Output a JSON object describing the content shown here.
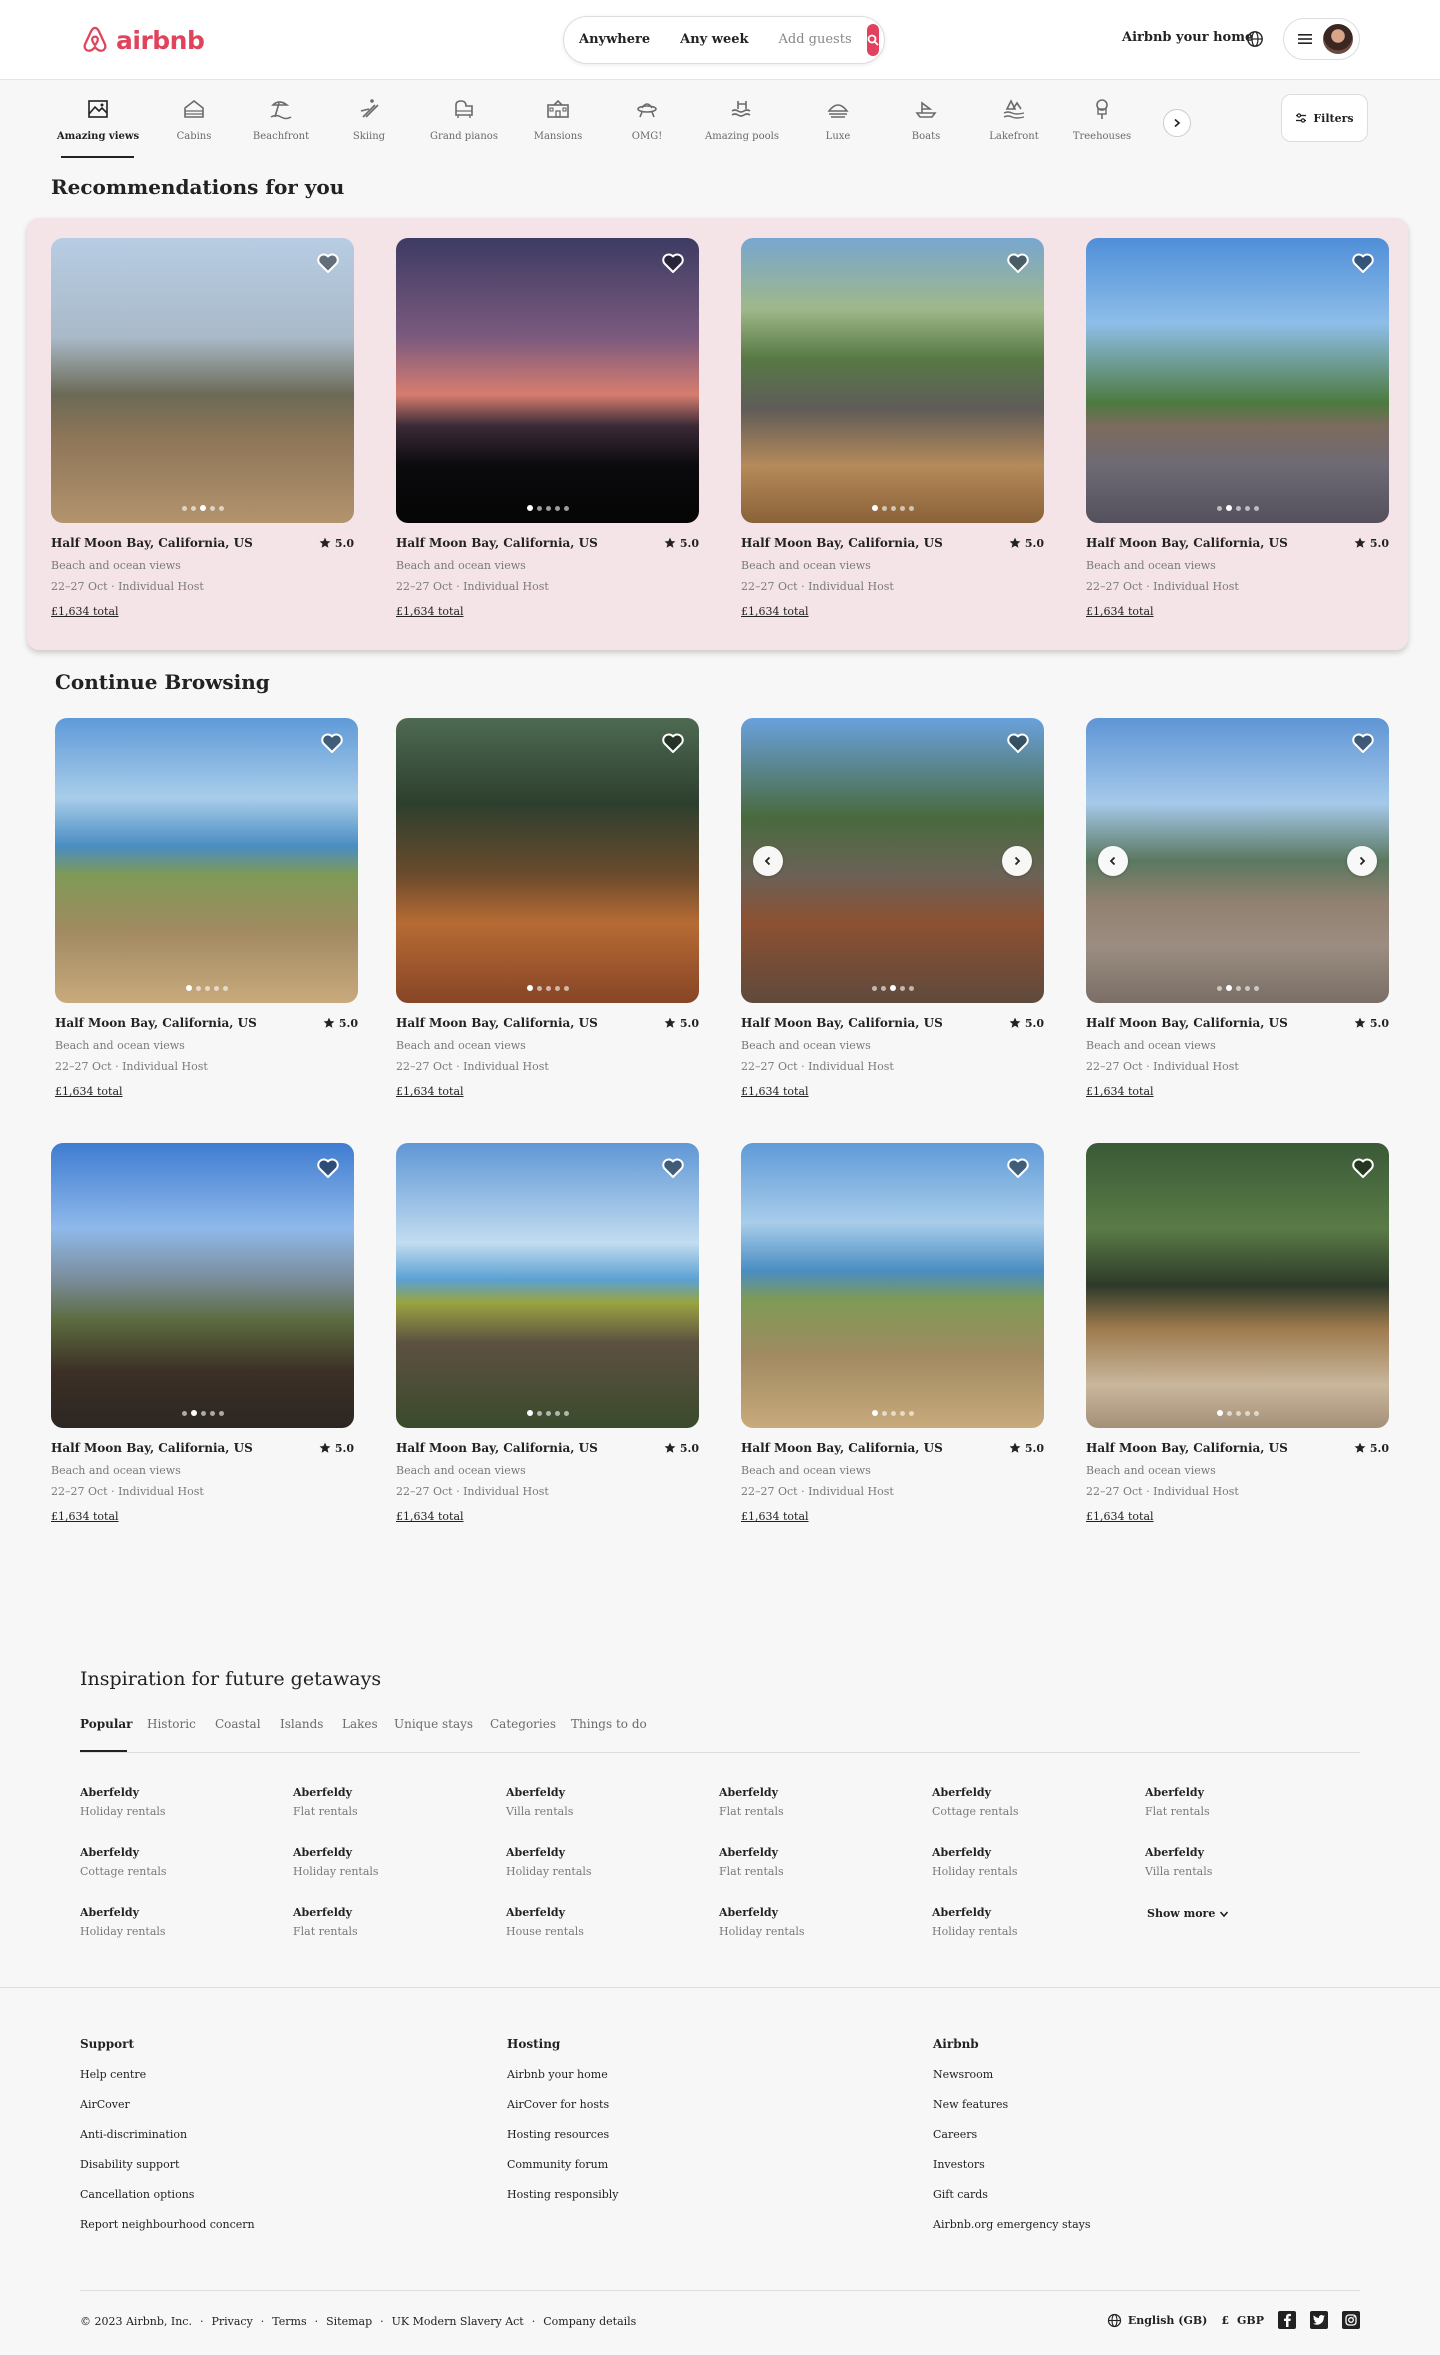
{
  "brand": {
    "name": "airbnb",
    "color": "#e0445c"
  },
  "search": {
    "where": "Anywhere",
    "when": "Any week",
    "guests": "Add guests"
  },
  "header": {
    "host_link": "Airbnb your home"
  },
  "categories": [
    {
      "label": "Amazing views",
      "icon": "mountain-view-icon",
      "active": true
    },
    {
      "label": "Cabins",
      "icon": "cabin-icon"
    },
    {
      "label": "Beachfront",
      "icon": "beachfront-icon"
    },
    {
      "label": "Skiing",
      "icon": "skiing-icon"
    },
    {
      "label": "Grand pianos",
      "icon": "piano-icon"
    },
    {
      "label": "Mansions",
      "icon": "mansion-icon"
    },
    {
      "label": "OMG!",
      "icon": "ufo-house-icon"
    },
    {
      "label": "Amazing pools",
      "icon": "pool-icon"
    },
    {
      "label": "Luxe",
      "icon": "luxe-icon"
    },
    {
      "label": "Boats",
      "icon": "boat-icon"
    },
    {
      "label": "Lakefront",
      "icon": "lakefront-icon"
    },
    {
      "label": "Treehouses",
      "icon": "treehouse-icon"
    }
  ],
  "filters_label": "Filters",
  "recommendations": {
    "title": "Recommendations for you",
    "listings": [
      {
        "location": "Half Moon Bay, California, US",
        "rating": "5.0",
        "subtitle": "Beach and ocean views",
        "dates": "22–27 Oct · Individual Host",
        "price": "£1,634 total",
        "active_dot": 2
      },
      {
        "location": "Half Moon Bay, California, US",
        "rating": "5.0",
        "subtitle": "Beach and ocean views",
        "dates": "22–27 Oct · Individual Host",
        "price": "£1,634 total",
        "active_dot": 0
      },
      {
        "location": "Half Moon Bay, California, US",
        "rating": "5.0",
        "subtitle": "Beach and ocean views",
        "dates": "22–27 Oct · Individual Host",
        "price": "£1,634 total",
        "active_dot": 0
      },
      {
        "location": "Half Moon Bay, California, US",
        "rating": "5.0",
        "subtitle": "Beach and ocean views",
        "dates": "22–27 Oct · Individual Host",
        "price": "£1,634 total",
        "active_dot": 1
      }
    ]
  },
  "continue": {
    "title": "Continue Browsing",
    "listings": [
      {
        "location": "Half Moon Bay, California, US",
        "rating": "5.0",
        "subtitle": "Beach and ocean views",
        "dates": "22–27 Oct · Individual Host",
        "price": "£1,634 total",
        "active_dot": 0
      },
      {
        "location": "Half Moon Bay, California, US",
        "rating": "5.0",
        "subtitle": "Beach and ocean views",
        "dates": "22–27 Oct · Individual Host",
        "price": "£1,634 total",
        "active_dot": 0
      },
      {
        "location": "Half Moon Bay, California, US",
        "rating": "5.0",
        "subtitle": "Beach and ocean views",
        "dates": "22–27 Oct · Individual Host",
        "price": "£1,634 total",
        "active_dot": 2
      },
      {
        "location": "Half Moon Bay, California, US",
        "rating": "5.0",
        "subtitle": "Beach and ocean views",
        "dates": "22–27 Oct · Individual Host",
        "price": "£1,634 total",
        "active_dot": 1
      },
      {
        "location": "Half Moon Bay, California, US",
        "rating": "5.0",
        "subtitle": "Beach and ocean views",
        "dates": "22–27 Oct · Individual Host",
        "price": "£1,634 total",
        "active_dot": 1
      },
      {
        "location": "Half Moon Bay, California, US",
        "rating": "5.0",
        "subtitle": "Beach and ocean views",
        "dates": "22–27 Oct · Individual Host",
        "price": "£1,634 total",
        "active_dot": 0
      },
      {
        "location": "Half Moon Bay, California, US",
        "rating": "5.0",
        "subtitle": "Beach and ocean views",
        "dates": "22–27 Oct · Individual Host",
        "price": "£1,634 total",
        "active_dot": 0
      },
      {
        "location": "Half Moon Bay, California, US",
        "rating": "5.0",
        "subtitle": "Beach and ocean views",
        "dates": "22–27 Oct · Individual Host",
        "price": "£1,634 total",
        "active_dot": 0
      }
    ]
  },
  "inspiration": {
    "title": "Inspiration for future getaways",
    "tabs": [
      "Popular",
      "Historic",
      "Coastal",
      "Islands",
      "Lakes",
      "Unique stays",
      "Categories",
      "Things to do"
    ],
    "items": [
      {
        "name": "Aberfeldy",
        "type": "Holiday rentals"
      },
      {
        "name": "Aberfeldy",
        "type": "Flat rentals"
      },
      {
        "name": "Aberfeldy",
        "type": "Villa rentals"
      },
      {
        "name": "Aberfeldy",
        "type": "Flat rentals"
      },
      {
        "name": "Aberfeldy",
        "type": "Cottage rentals"
      },
      {
        "name": "Aberfeldy",
        "type": "Flat rentals"
      },
      {
        "name": "Aberfeldy",
        "type": "Cottage rentals"
      },
      {
        "name": "Aberfeldy",
        "type": "Holiday rentals"
      },
      {
        "name": "Aberfeldy",
        "type": "Holiday rentals"
      },
      {
        "name": "Aberfeldy",
        "type": "Flat rentals"
      },
      {
        "name": "Aberfeldy",
        "type": "Holiday rentals"
      },
      {
        "name": "Aberfeldy",
        "type": "Villa rentals"
      },
      {
        "name": "Aberfeldy",
        "type": "Holiday rentals"
      },
      {
        "name": "Aberfeldy",
        "type": "Flat rentals"
      },
      {
        "name": "Aberfeldy",
        "type": "House rentals"
      },
      {
        "name": "Aberfeldy",
        "type": "Holiday rentals"
      },
      {
        "name": "Aberfeldy",
        "type": "Holiday rentals"
      }
    ],
    "show_more": "Show more"
  },
  "footer": {
    "support": {
      "title": "Support",
      "links": [
        "Help centre",
        "AirCover",
        "Anti-discrimination",
        "Disability support",
        "Cancellation options",
        "Report neighbourhood concern"
      ]
    },
    "hosting": {
      "title": "Hosting",
      "links": [
        "Airbnb your home",
        "AirCover for hosts",
        "Hosting resources",
        "Community forum",
        "Hosting responsibly"
      ]
    },
    "airbnb": {
      "title": "Airbnb",
      "links": [
        "Newsroom",
        "New features",
        "Careers",
        "Investors",
        "Gift cards",
        "Airbnb.org emergency stays"
      ]
    },
    "copyright": "© 2023 Airbnb, Inc.",
    "legal": [
      "Privacy",
      "Terms",
      "Sitemap",
      "UK Modern Slavery Act",
      "Company details"
    ],
    "language": "English (GB)",
    "currency_symbol": "£",
    "currency": "GBP"
  }
}
